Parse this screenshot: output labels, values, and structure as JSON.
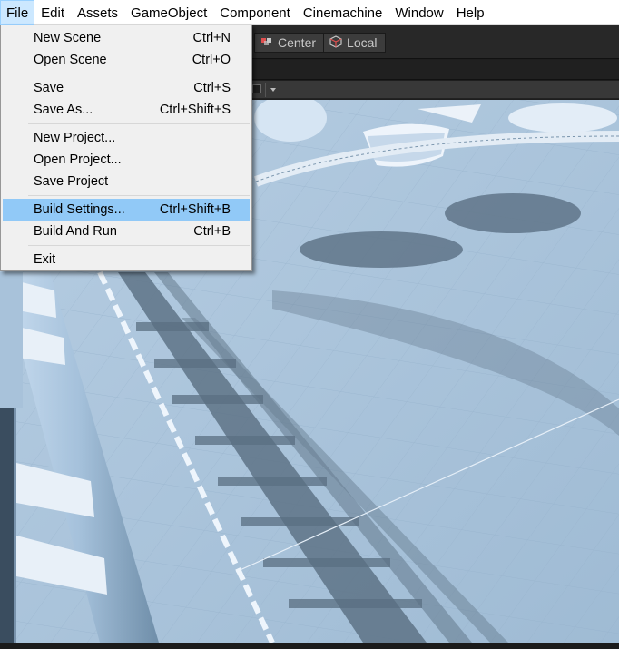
{
  "menubar": {
    "items": [
      "File",
      "Edit",
      "Assets",
      "GameObject",
      "Component",
      "Cinemachine",
      "Window",
      "Help"
    ],
    "active_index": 0
  },
  "toolbar": {
    "pivot_center_label": "Center",
    "pivot_local_label": "Local"
  },
  "file_menu": {
    "groups": [
      [
        {
          "label": "New Scene",
          "shortcut": "Ctrl+N"
        },
        {
          "label": "Open Scene",
          "shortcut": "Ctrl+O"
        }
      ],
      [
        {
          "label": "Save",
          "shortcut": "Ctrl+S"
        },
        {
          "label": "Save As...",
          "shortcut": "Ctrl+Shift+S"
        }
      ],
      [
        {
          "label": "New Project...",
          "shortcut": ""
        },
        {
          "label": "Open Project...",
          "shortcut": ""
        },
        {
          "label": "Save Project",
          "shortcut": ""
        }
      ],
      [
        {
          "label": "Build Settings...",
          "shortcut": "Ctrl+Shift+B",
          "highlighted": true
        },
        {
          "label": "Build And Run",
          "shortcut": "Ctrl+B"
        }
      ],
      [
        {
          "label": "Exit",
          "shortcut": ""
        }
      ]
    ]
  },
  "colors": {
    "highlight": "#91c9f7",
    "menu_bg": "#f0f0f0",
    "scene_floor": "#a9c4dc",
    "scene_shadow": "#5a6f82"
  }
}
